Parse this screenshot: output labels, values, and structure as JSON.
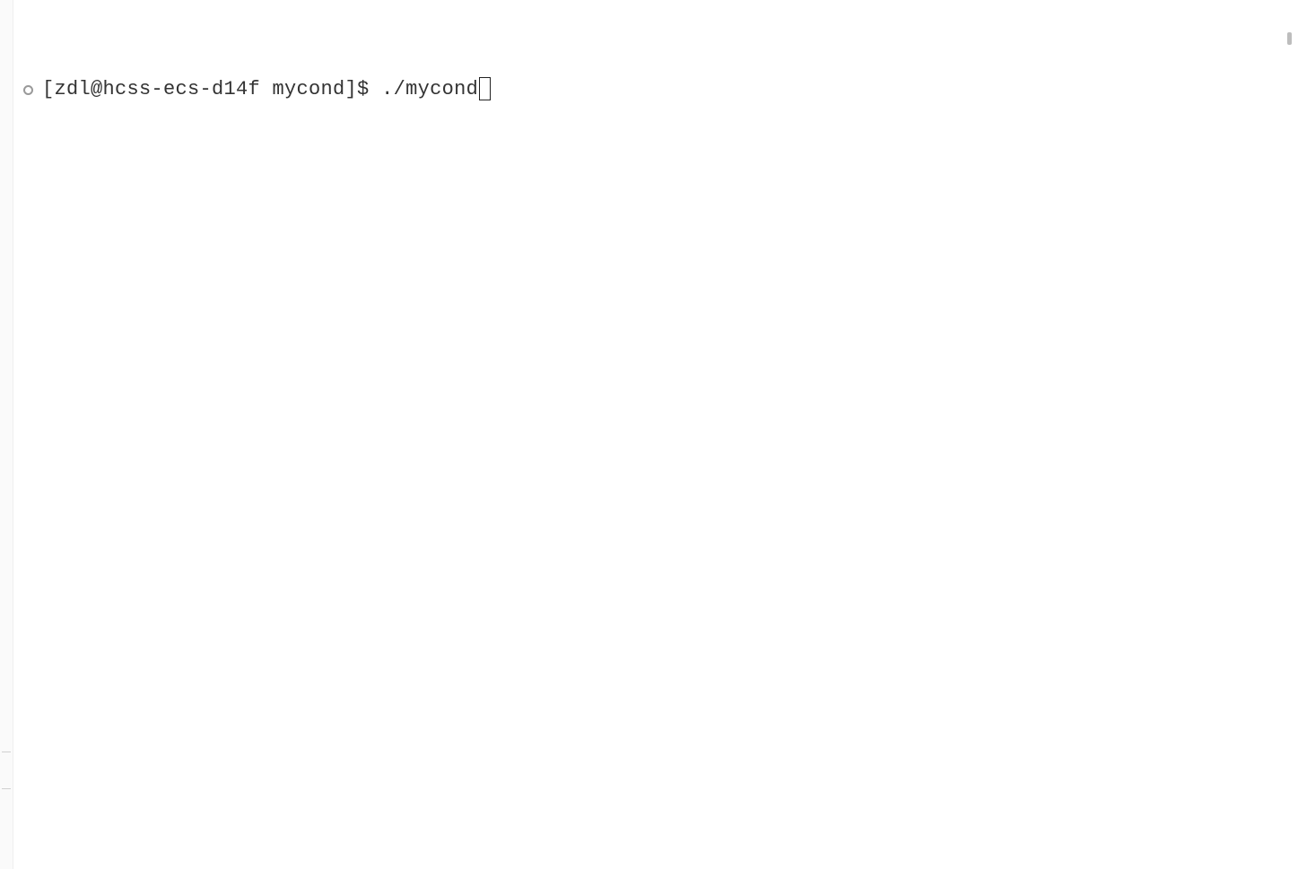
{
  "terminal": {
    "prompt": "[zdl@hcss-ecs-d14f mycond]$ ",
    "command": "./mycond"
  }
}
